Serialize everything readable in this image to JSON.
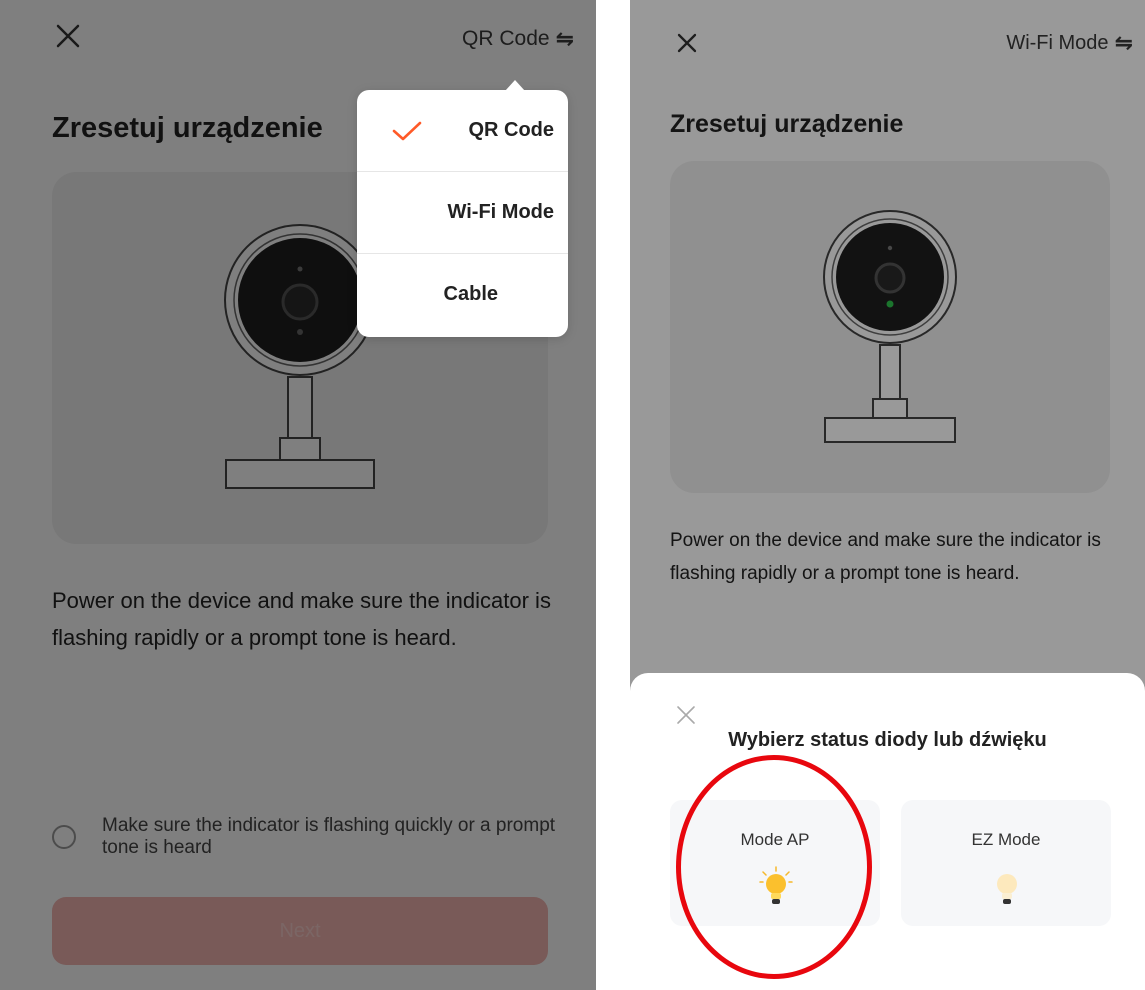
{
  "left": {
    "top_mode_label": "QR Code",
    "title": "Zresetuj urządzenie",
    "description": "Power on the device and make sure the indicator is flashing rapidly or a prompt tone is heard.",
    "confirm_text": "Make sure the indicator is flashing quickly or a prompt tone is heard",
    "next_label": "Next",
    "mode_menu": {
      "items": [
        {
          "label": "QR Code",
          "selected": true
        },
        {
          "label": "Wi-Fi Mode",
          "selected": false
        },
        {
          "label": "Cable",
          "selected": false
        }
      ]
    }
  },
  "right": {
    "top_mode_label": "Wi-Fi Mode",
    "title": "Zresetuj urządzenie",
    "description": "Power on the device and make sure the indicator is flashing rapidly or a prompt tone is heard.",
    "sheet": {
      "title": "Wybierz status diody lub dźwięku",
      "options": [
        {
          "label": "Mode AP",
          "icon": "bulb-on-icon"
        },
        {
          "label": "EZ Mode",
          "icon": "bulb-dim-icon"
        }
      ]
    }
  },
  "colors": {
    "accent": "#ff5a28",
    "next_button": "#f2b5b1",
    "highlight_circle": "#e8070e",
    "camera_led_green": "#2ec34c"
  }
}
